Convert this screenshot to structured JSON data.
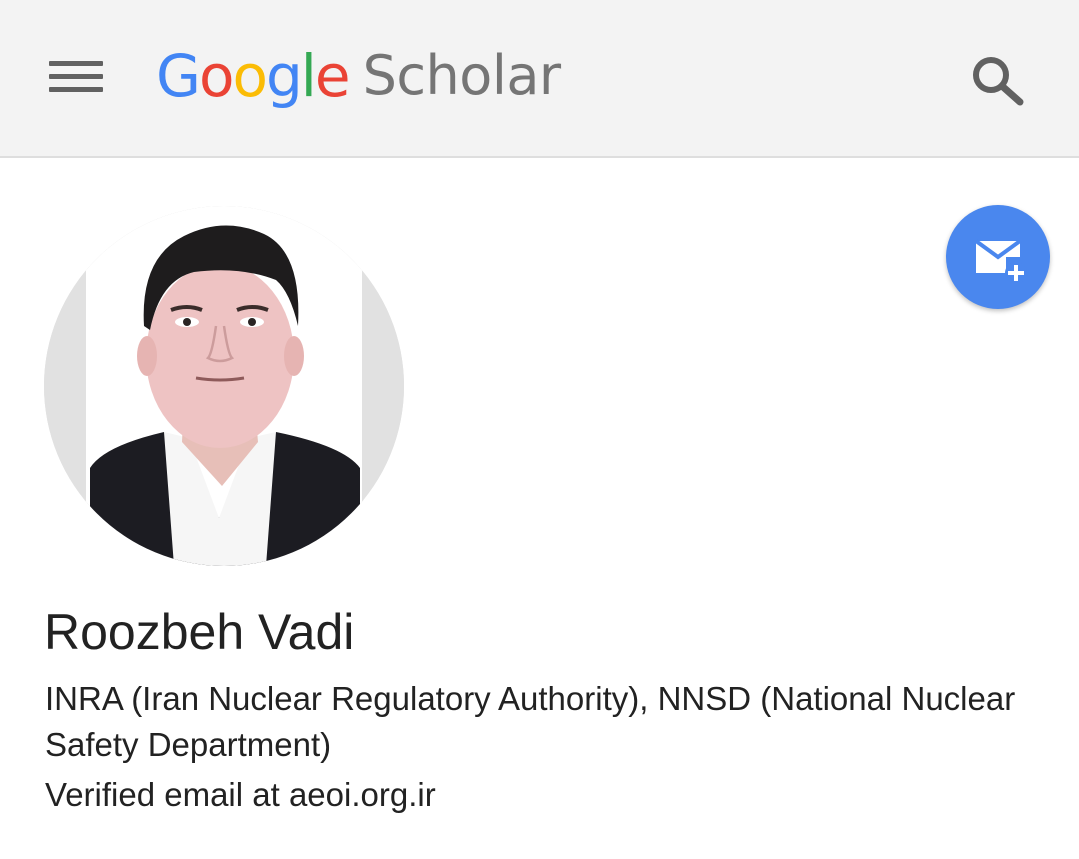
{
  "header": {
    "logo_google": "Google",
    "logo_scholar": "Scholar",
    "menu_icon": "hamburger-menu-icon",
    "search_icon": "search-icon"
  },
  "profile": {
    "name": "Roozbeh Vadi",
    "affiliation": "INRA (Iran Nuclear Regulatory Authority), NNSD (National Nuclear Safety Department)",
    "email": "Verified email at aeoi.org.ir",
    "avatar_icon": "profile-photo",
    "follow_icon": "email-plus-icon"
  },
  "colors": {
    "header_bg": "#f3f3f3",
    "follow_button": "#4a87ee",
    "google_blue": "#4285f4",
    "google_red": "#ea4335",
    "google_yellow": "#fbbc05",
    "google_green": "#34a853",
    "text": "#222222"
  }
}
